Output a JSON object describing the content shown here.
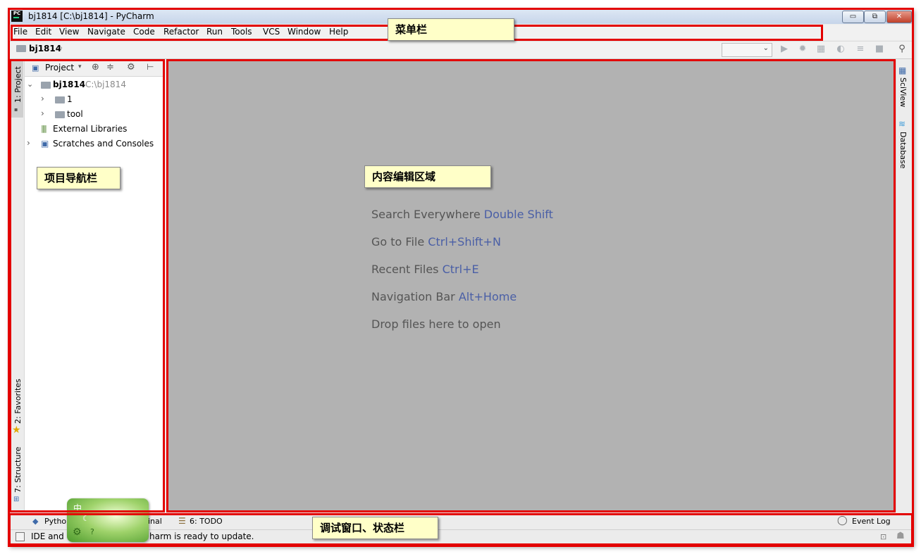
{
  "window": {
    "title": "bj1814 [C:\\bj1814] - PyCharm",
    "logo": "PC",
    "controls": {
      "minimize": "▭",
      "restore": "⧉",
      "close": "✕"
    }
  },
  "menu": {
    "items": [
      "File",
      "Edit",
      "View",
      "Navigate",
      "Code",
      "Refactor",
      "Run",
      "Tools",
      "VCS",
      "Window",
      "Help"
    ]
  },
  "navbar": {
    "breadcrumb": "bj1814"
  },
  "left_strip": {
    "project": "1: Project",
    "favorites": "2: Favorites",
    "structure": "7: Structure"
  },
  "right_strip": {
    "sciview": "SciView",
    "database": "Database"
  },
  "project_panel": {
    "header": "Project",
    "tree": [
      {
        "label": "bj1814",
        "path": "C:\\bj1814"
      },
      {
        "label": "1"
      },
      {
        "label": "tool"
      },
      {
        "label": "External Libraries"
      },
      {
        "label": "Scratches and Consoles"
      }
    ]
  },
  "editor": {
    "hints": [
      {
        "text": "Search Everywhere",
        "key": "Double Shift"
      },
      {
        "text": "Go to File",
        "key": "Ctrl+Shift+N"
      },
      {
        "text": "Recent Files",
        "key": "Ctrl+E"
      },
      {
        "text": "Navigation Bar",
        "key": "Alt+Home"
      },
      {
        "text": "Drop files here to open",
        "key": ""
      }
    ]
  },
  "bottom_tabs": {
    "python": "Pytho",
    "terminal": "inal",
    "todo": "6: TODO",
    "event_log": "Event Log"
  },
  "status": {
    "left": "IDE and",
    "right": "harm is ready to update."
  },
  "annotations": {
    "menubar": "菜单栏",
    "project_nav": "项目导航栏",
    "editor_area": "内容编辑区域",
    "debug_status": "调试窗口、状态栏"
  },
  "ime": {
    "label": "中"
  },
  "colors": {
    "annotation_border": "#e30000",
    "callout_bg": "#ffffc8",
    "editor_bg": "#b2b2b2",
    "shortcut": "#4a5fa6"
  }
}
